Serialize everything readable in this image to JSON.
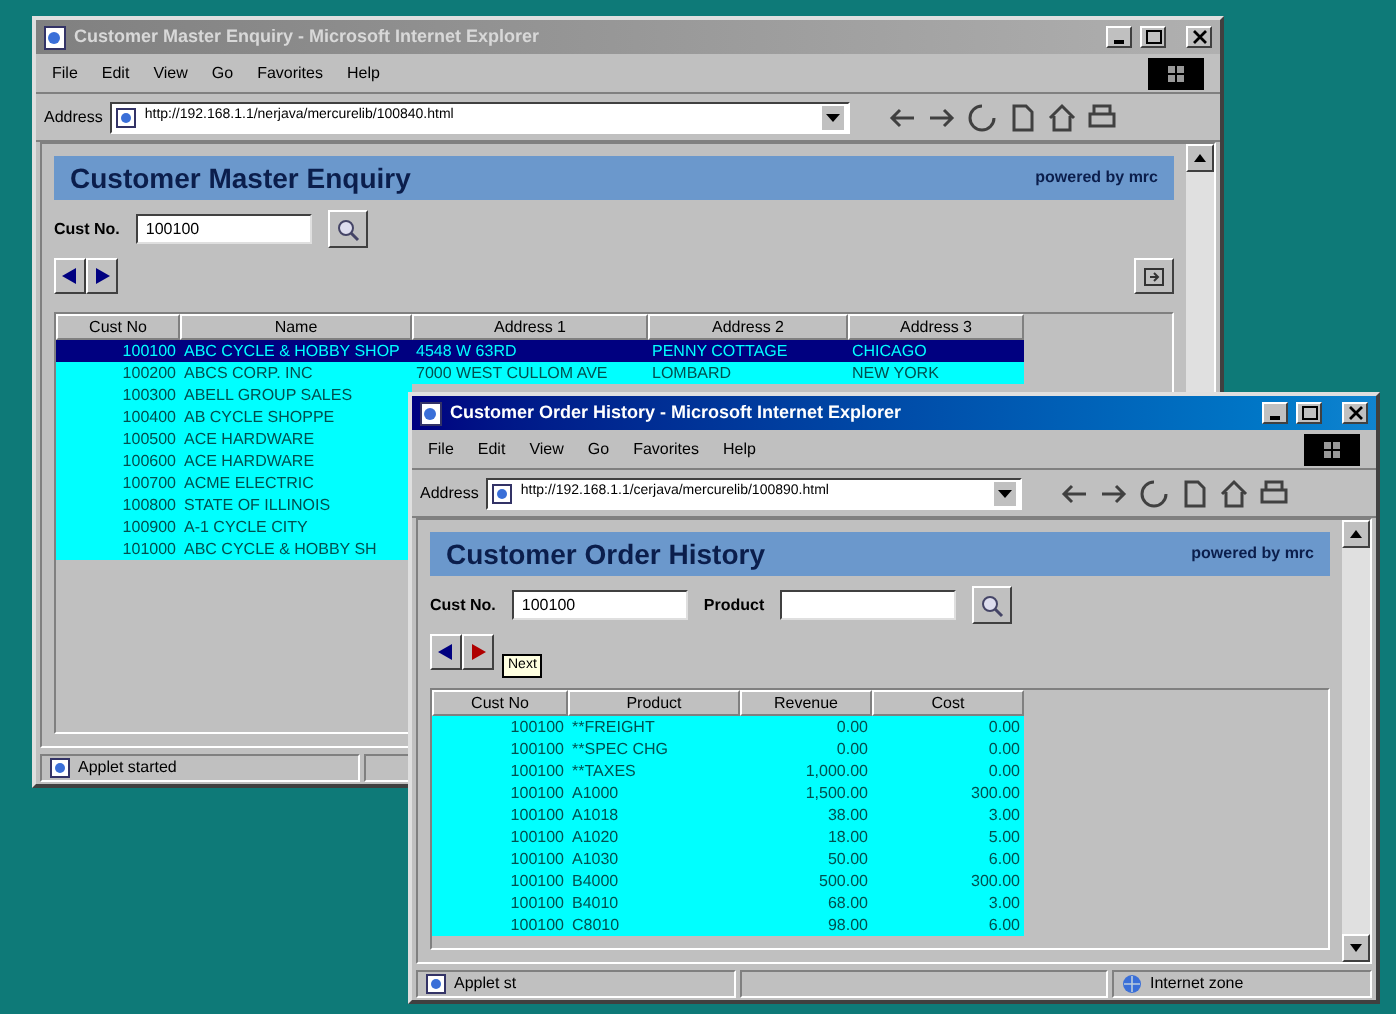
{
  "windows": [
    {
      "title": "Customer Master Enquiry - Microsoft Internet Explorer",
      "active": false,
      "menu": [
        "File",
        "Edit",
        "View",
        "Go",
        "Favorites",
        "Help"
      ],
      "address_label": "Address",
      "address": "http://192.168.1.1/nerjava/mercurelib/100840.html",
      "page_title": "Customer Master Enquiry",
      "powered": "powered by mrc",
      "fields": [
        {
          "label": "Cust No.",
          "value": "100100"
        }
      ],
      "columns": [
        "Cust No",
        "Name",
        "Address 1",
        "Address 2",
        "Address 3"
      ],
      "rows": [
        {
          "cells": [
            "100100",
            "ABC CYCLE & HOBBY SHOP",
            "4548 W 63RD",
            "PENNY COTTAGE",
            "CHICAGO"
          ],
          "selected": true
        },
        {
          "cells": [
            "100200",
            "ABCS CORP. INC",
            "7000 WEST CULLOM AVE",
            "LOMBARD",
            "NEW YORK"
          ],
          "selected": false
        },
        {
          "cells": [
            "100300",
            "ABELL GROUP SALES"
          ],
          "selected": false
        },
        {
          "cells": [
            "100400",
            "AB CYCLE SHOPPE"
          ],
          "selected": false
        },
        {
          "cells": [
            "100500",
            "ACE HARDWARE"
          ],
          "selected": false
        },
        {
          "cells": [
            "100600",
            "ACE HARDWARE"
          ],
          "selected": false
        },
        {
          "cells": [
            "100700",
            "ACME ELECTRIC"
          ],
          "selected": false
        },
        {
          "cells": [
            "100800",
            "STATE OF ILLINOIS"
          ],
          "selected": false
        },
        {
          "cells": [
            "100900",
            "A-1 CYCLE CITY"
          ],
          "selected": false
        },
        {
          "cells": [
            "101000",
            "ABC CYCLE & HOBBY SH"
          ],
          "selected": false
        }
      ],
      "status": "Applet started"
    },
    {
      "title": "Customer Order History - Microsoft Internet Explorer",
      "active": true,
      "menu": [
        "File",
        "Edit",
        "View",
        "Go",
        "Favorites",
        "Help"
      ],
      "address_label": "Address",
      "address": "http://192.168.1.1/cerjava/mercurelib/100890.html",
      "page_title": "Customer Order History",
      "powered": "powered by mrc",
      "fields": [
        {
          "label": "Cust No.",
          "value": "100100"
        },
        {
          "label": "Product"
        }
      ],
      "tooltip": "Next",
      "columns": [
        "Cust No",
        "Product",
        "Revenue",
        "Cost"
      ],
      "rows": [
        {
          "cells": [
            "100100",
            "**FREIGHT",
            "0.00",
            "0.00"
          ],
          "selected": false
        },
        {
          "cells": [
            "100100",
            "**SPEC CHG",
            "0.00",
            "0.00"
          ],
          "selected": false
        },
        {
          "cells": [
            "100100",
            "**TAXES",
            "1,000.00",
            "0.00"
          ],
          "selected": false
        },
        {
          "cells": [
            "100100",
            "A1000",
            "1,500.00",
            "300.00"
          ],
          "selected": false
        },
        {
          "cells": [
            "100100",
            "A1018",
            "38.00",
            "3.00"
          ],
          "selected": false
        },
        {
          "cells": [
            "100100",
            "A1020",
            "18.00",
            "5.00"
          ],
          "selected": false
        },
        {
          "cells": [
            "100100",
            "A1030",
            "50.00",
            "6.00"
          ],
          "selected": false
        },
        {
          "cells": [
            "100100",
            "B4000",
            "500.00",
            "300.00"
          ],
          "selected": false
        },
        {
          "cells": [
            "100100",
            "B4010",
            "68.00",
            "3.00"
          ],
          "selected": false
        },
        {
          "cells": [
            "100100",
            "C8010",
            "98.00",
            "6.00"
          ],
          "selected": false
        }
      ],
      "status": "Applet st",
      "zone": "Internet zone"
    }
  ]
}
